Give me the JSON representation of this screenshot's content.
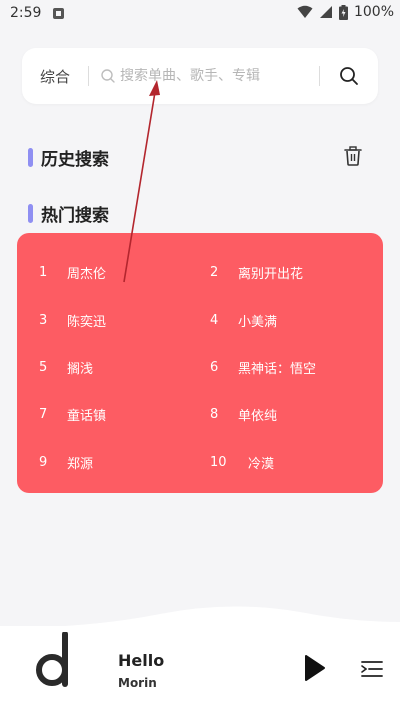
{
  "status_bar": {
    "time": "2:59",
    "battery": "100%",
    "icons": [
      "notification-icon",
      "wifi-icon",
      "cell-signal-icon",
      "battery-icon"
    ]
  },
  "search": {
    "scope_label": "综合",
    "placeholder": "搜索单曲、歌手、专辑",
    "button_icon": "search-icon"
  },
  "history": {
    "title": "历史搜索",
    "clear_icon": "trash-icon"
  },
  "hot": {
    "title": "热门搜索",
    "items": [
      {
        "rank": "1",
        "name": "周杰伦"
      },
      {
        "rank": "2",
        "name": "离别开出花"
      },
      {
        "rank": "3",
        "name": "陈奕迅"
      },
      {
        "rank": "4",
        "name": "小美满"
      },
      {
        "rank": "5",
        "name": "搁浅"
      },
      {
        "rank": "6",
        "name": "黑神话：悟空"
      },
      {
        "rank": "7",
        "name": "童话镇"
      },
      {
        "rank": "8",
        "name": "单依纯"
      },
      {
        "rank": "9",
        "name": "郑源"
      },
      {
        "rank": "10",
        "name": "冷漠"
      }
    ]
  },
  "player": {
    "song_title": "Hello",
    "artist": "Morin",
    "play_icon": "play-icon",
    "playlist_icon": "playlist-icon"
  },
  "colors": {
    "accent_bar": "#8f8ff2",
    "hot_card_bg": "#fd5c63",
    "annotation_arrow": "#b3262e"
  }
}
